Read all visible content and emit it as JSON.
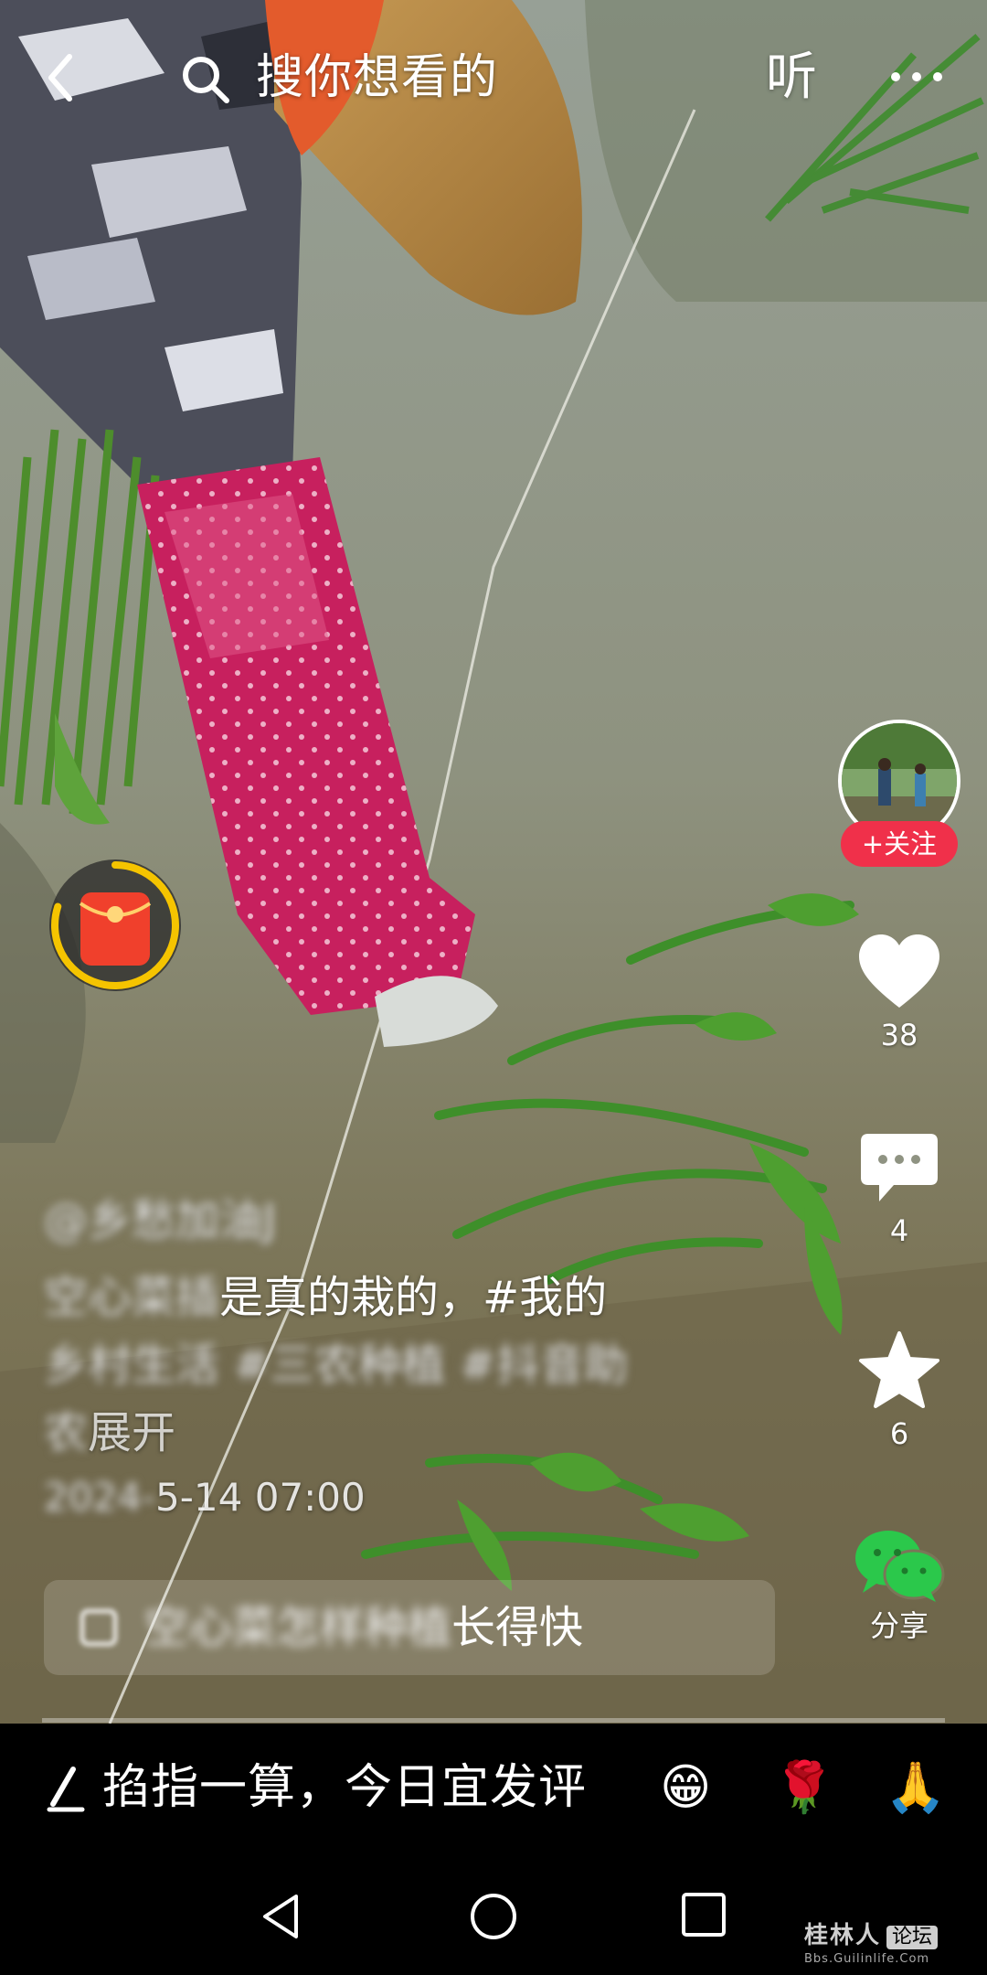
{
  "top_bar": {
    "search_placeholder": "搜你想看的",
    "listen_label": "听",
    "back_icon": "chevron-left-icon",
    "search_icon": "search-icon",
    "more_icon": "more-dots-icon"
  },
  "red_packet": {
    "icon": "red-packet-icon",
    "progress": 0.8
  },
  "creator": {
    "follow_label": "+关注"
  },
  "actions": {
    "like_count": "38",
    "comment_count": "4",
    "favorite_count": "6",
    "share_label": "分享"
  },
  "caption": {
    "author": "@乡愁加油J",
    "line1_prefix": "空心菜插",
    "line1_visible": "是真的栽的，#我的",
    "line2": "乡村生活 #三农种植 #抖音助",
    "line3_blur": "农",
    "expand_label": "展开",
    "date_prefix": "2024-",
    "date_visible": "5-14 07:00"
  },
  "search_pill": {
    "blur_text": "空心菜怎样种植",
    "visible_text": "长得快"
  },
  "comment_bar": {
    "hint": "掐指一算，今日宜发评",
    "emojis": [
      "😁",
      "🌹",
      "🙏"
    ]
  },
  "watermark": {
    "title": "桂林人",
    "tag": "论坛",
    "url": "Bbs.Guilinlife.Com"
  },
  "colors": {
    "follow_red": "#f0304a",
    "share_green": "#2bc84b",
    "packet_red": "#f0402c",
    "ring_yellow": "#f5c400"
  }
}
